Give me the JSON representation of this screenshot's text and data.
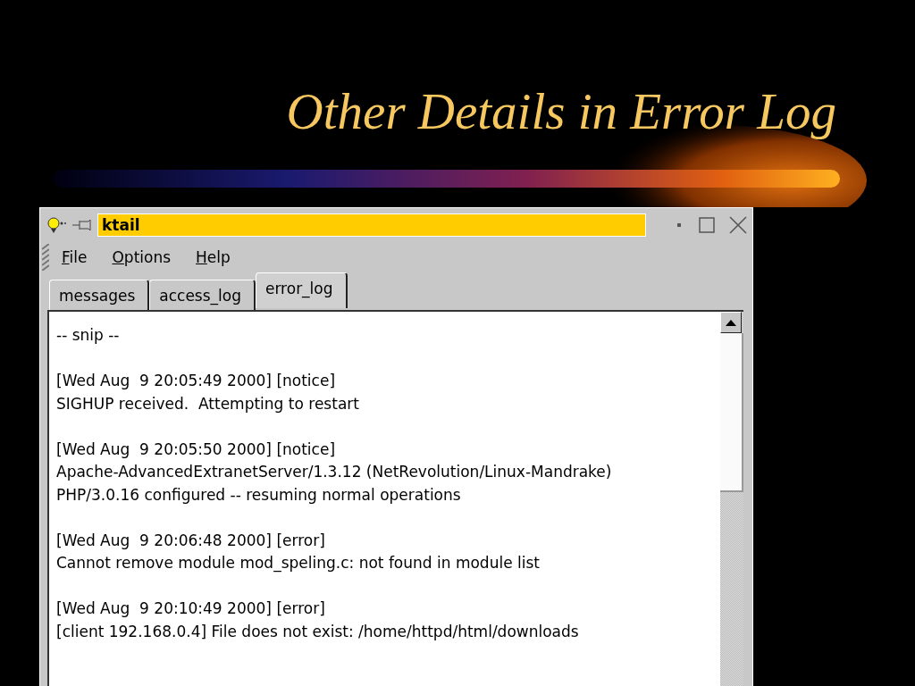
{
  "slide_title": "Other Details in Error Log",
  "window": {
    "title": "ktail"
  },
  "menu": [
    "File",
    "Options",
    "Help"
  ],
  "tabs": [
    {
      "label": "messages",
      "selected": false
    },
    {
      "label": "access_log",
      "selected": false
    },
    {
      "label": "error_log",
      "selected": true
    }
  ],
  "log": [
    [
      "-- snip --"
    ],
    [
      "[Wed Aug  9 20:05:49 2000] [notice]",
      "SIGHUP received.  Attempting to restart"
    ],
    [
      "[Wed Aug  9 20:05:50 2000] [notice]",
      "Apache-AdvancedExtranetServer/1.3.12 (NetRevolution/Linux-Mandrake)",
      "PHP/3.0.16 configured -- resuming normal operations"
    ],
    [
      "[Wed Aug  9 20:06:48 2000] [error]",
      "Cannot remove module mod_speling.c: not found in module list"
    ],
    [
      "[Wed Aug  9 20:10:49 2000] [error]",
      "[client 192.168.0.4] File does not exist: /home/httpd/html/downloads"
    ]
  ]
}
